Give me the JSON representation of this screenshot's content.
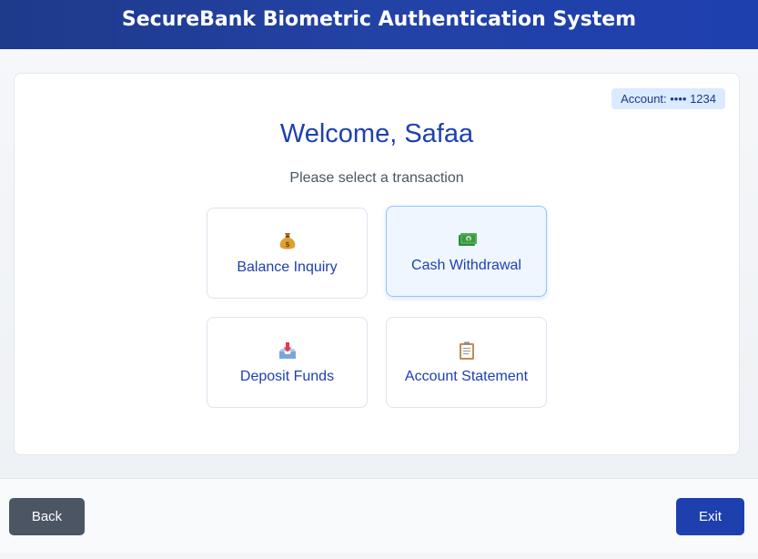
{
  "header": {
    "title": "SecureBank Biometric Authentication System"
  },
  "account": {
    "badge": "Account: •••• 1234"
  },
  "welcome": {
    "heading": "Welcome, Safaa",
    "subtitle": "Please select a transaction"
  },
  "transactions": [
    {
      "label": "Balance Inquiry",
      "icon": "money-bag-icon"
    },
    {
      "label": "Cash Withdrawal",
      "icon": "banknote-icon",
      "active": true
    },
    {
      "label": "Deposit Funds",
      "icon": "inbox-tray-icon"
    },
    {
      "label": "Account Statement",
      "icon": "clipboard-icon"
    }
  ],
  "footer": {
    "back_label": "Back",
    "exit_label": "Exit"
  },
  "colors": {
    "primary": "#1e40af",
    "header": "#1e3a8a",
    "back_button": "#4b5563",
    "badge_bg": "#dbeafe"
  }
}
